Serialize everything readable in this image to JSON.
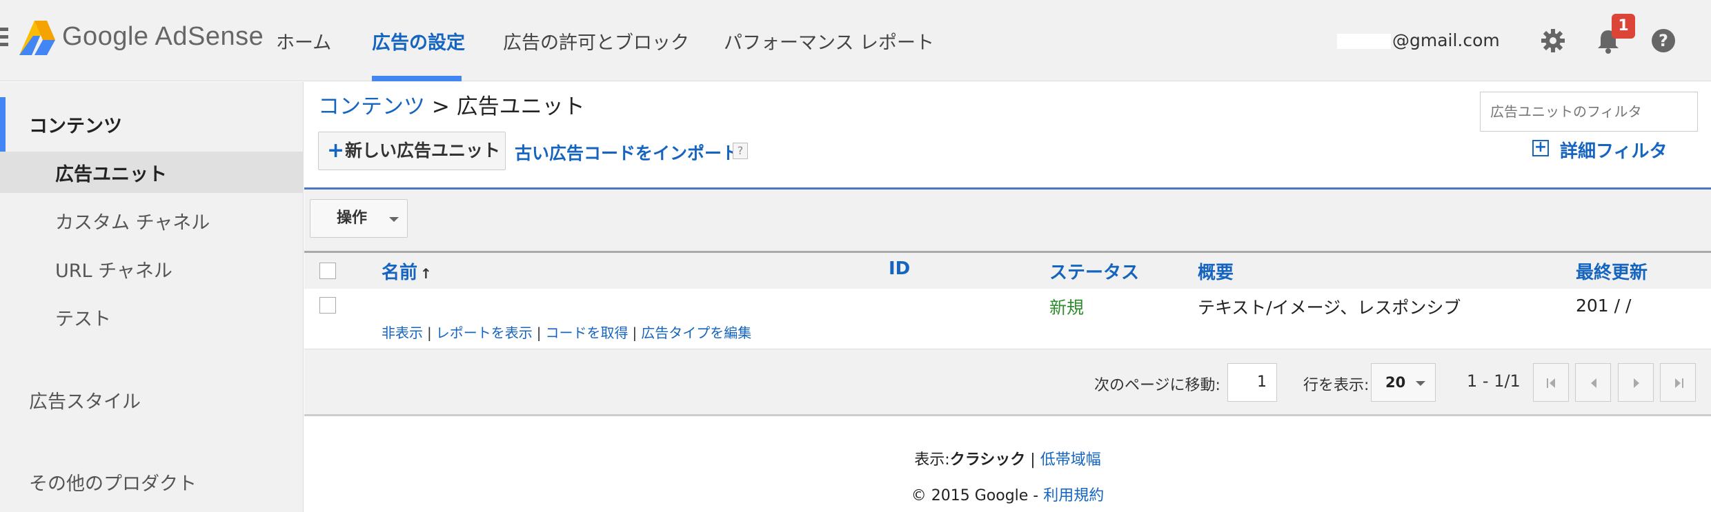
{
  "header": {
    "logo_text": "Google AdSense",
    "nav": [
      "ホーム",
      "広告の設定",
      "広告の許可とブロック",
      "パフォーマンス レポート"
    ],
    "account_suffix": "@gmail.com",
    "notification_count": "1",
    "accent_color": "#4285f4"
  },
  "sidebar": {
    "section_contents": "コンテンツ",
    "items": [
      "広告ユニット",
      "カスタム チャネル",
      "URL チャネル",
      "テスト"
    ],
    "section_ad_style": "広告スタイル",
    "section_other_products": "その他のプロダクト"
  },
  "main": {
    "breadcrumb_link": "コンテンツ",
    "breadcrumb_sep": " > ",
    "breadcrumb_current": "広告ユニット",
    "new_button_label": "新しい広告ユニット",
    "import_link": "古い広告コードをインポート",
    "help_label": "?",
    "filter_placeholder": "広告ユニットのフィルタ",
    "advanced_filter_label": "詳細フィルタ",
    "operations_label": "操作"
  },
  "table": {
    "columns": [
      "名前",
      "ID",
      "ステータス",
      "概要",
      "最終更新"
    ],
    "sort_indicator": "↑",
    "rows": [
      {
        "name": "",
        "id": "",
        "status": "新規",
        "summary": "テキスト/イメージ、レスポンシブ",
        "updated": "201 /  /",
        "actions": [
          "非表示",
          "レポートを表示",
          "コードを取得",
          "広告タイプを編集"
        ]
      }
    ]
  },
  "pager": {
    "goto_label": "次のページに移動:",
    "page_value": "1",
    "rows_label": "行を表示:",
    "rows_value": "20",
    "range_text": "1 - 1/1"
  },
  "footer": {
    "view_label": "表示:",
    "view_classic": "クラシック",
    "view_sep": " | ",
    "view_low_bandwidth": "低帯域幅",
    "copyright": "© 2015 Google - ",
    "terms_link": "利用規約"
  }
}
